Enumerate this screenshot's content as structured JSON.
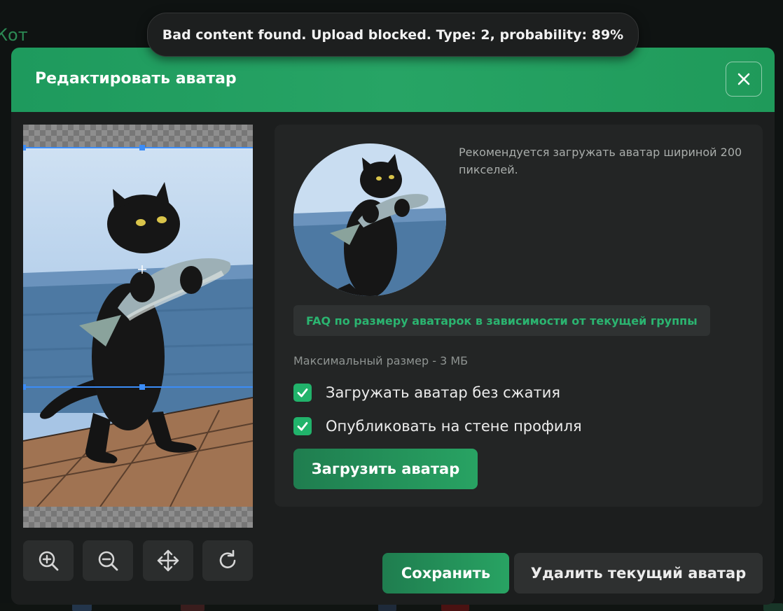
{
  "background": {
    "partial_text": "Кот"
  },
  "toast": {
    "message": "Bad content found. Upload blocked. Type: 2, probability: 89%"
  },
  "modal": {
    "title": "Редактировать аватар",
    "close_icon": "close-icon",
    "toolbar": [
      {
        "name": "zoom-in-icon"
      },
      {
        "name": "zoom-out-icon"
      },
      {
        "name": "move-icon"
      },
      {
        "name": "rotate-icon"
      }
    ],
    "panel": {
      "recommendation": "Рекомендуется загружать аватар шириной 200 пикселей.",
      "faq_link": "FAQ по размеру аватарок в зависимости от текущей группы",
      "max_size": "Максимальный размер - 3 МБ",
      "checkboxes": [
        {
          "label": "Загружать аватар без сжатия",
          "checked": true
        },
        {
          "label": "Опубликовать на стене профиля",
          "checked": true
        }
      ],
      "upload_label": "Загрузить аватар"
    },
    "save_label": "Сохранить",
    "delete_label": "Удалить текущий аватар"
  },
  "colors": {
    "accent": "#24a063",
    "header": "#1e9a5d",
    "link": "#2bb470",
    "modal_bg": "#1c1e1e"
  }
}
